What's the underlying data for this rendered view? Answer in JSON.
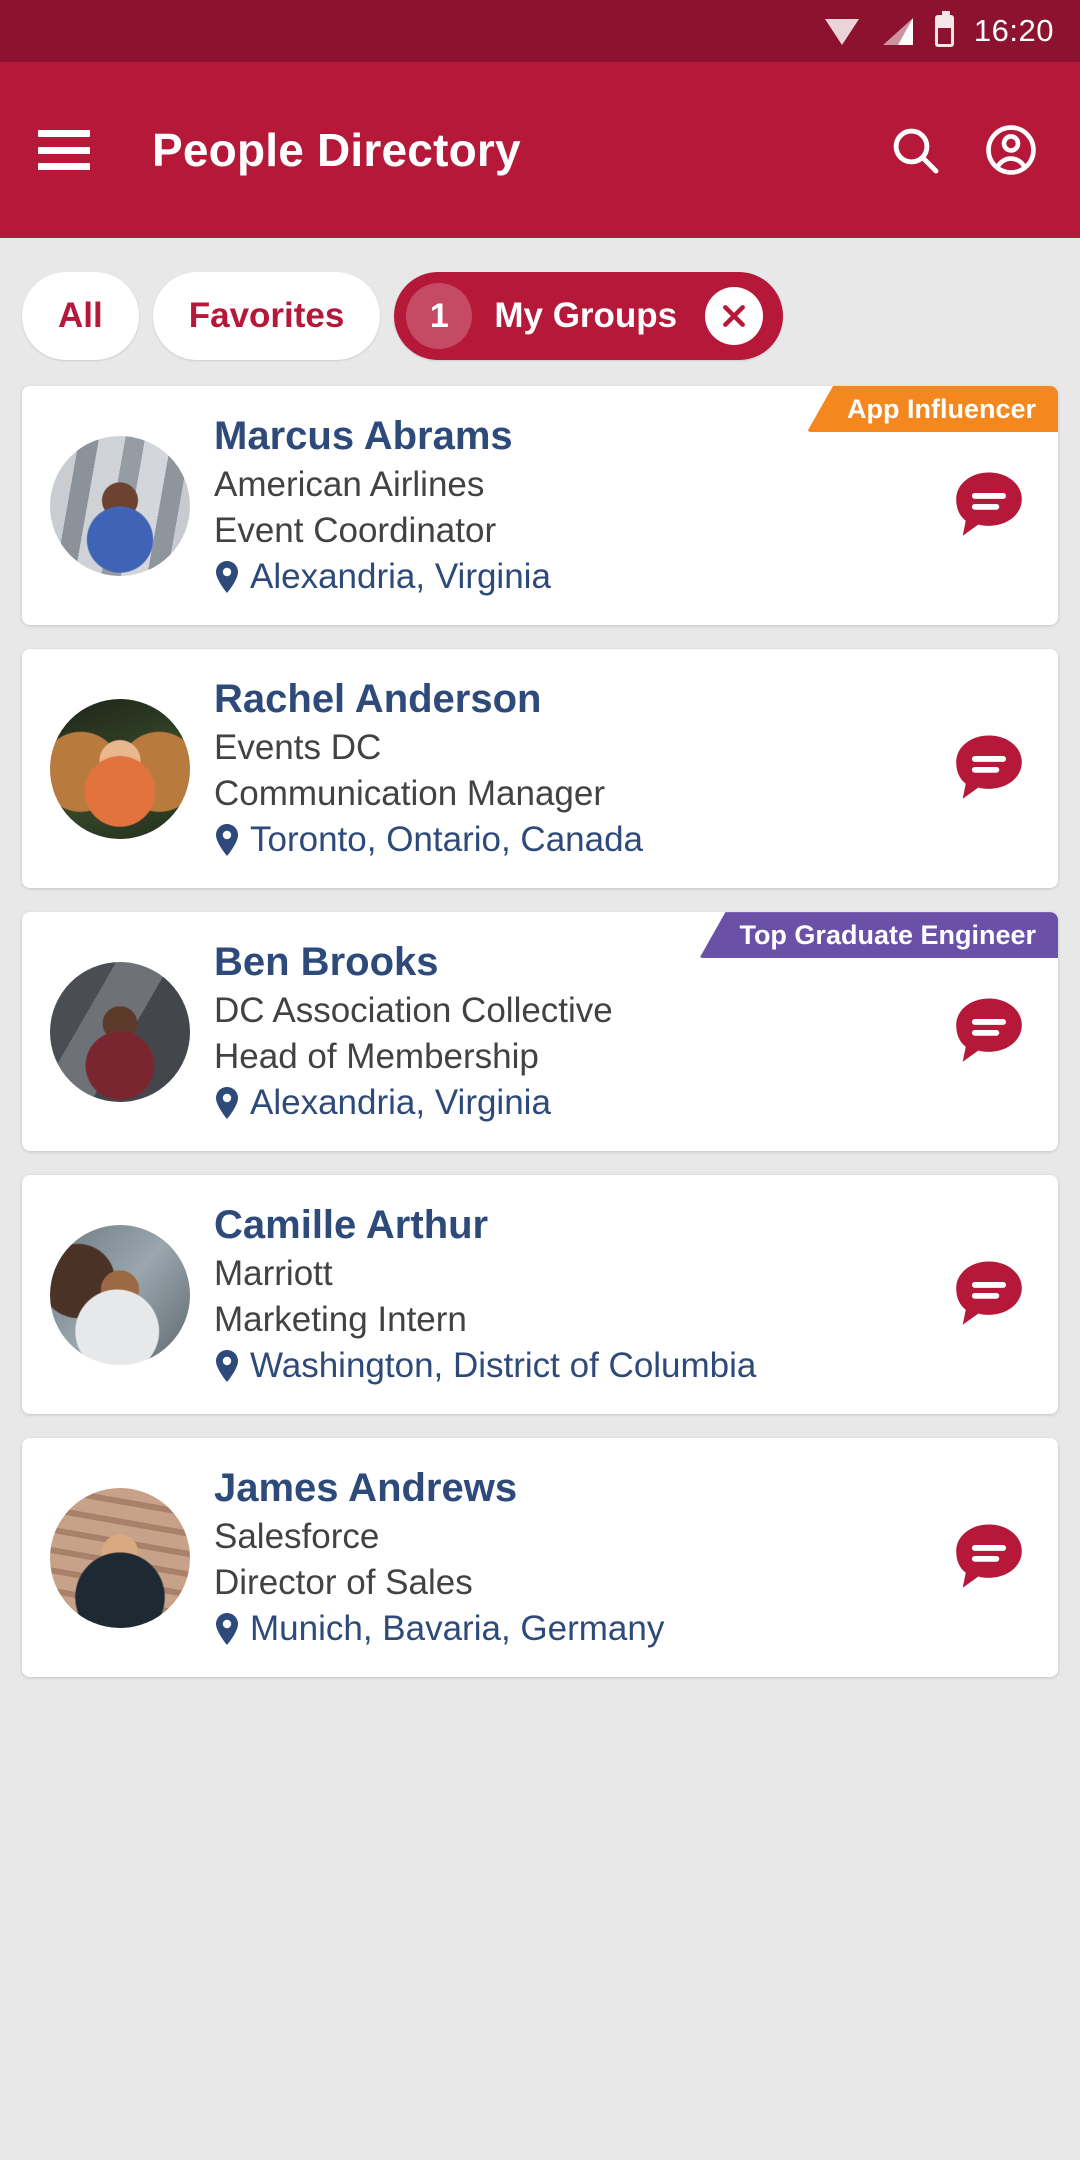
{
  "status_bar": {
    "time": "16:20",
    "icons": [
      "wifi-icon",
      "signal-icon",
      "battery-icon"
    ]
  },
  "app_bar": {
    "title": "People Directory",
    "menu_icon": "hamburger-menu-icon",
    "search_icon": "search-icon",
    "account_icon": "account-icon"
  },
  "filters": {
    "chips": [
      {
        "label": "All",
        "active": false
      },
      {
        "label": "Favorites",
        "active": false
      },
      {
        "label": "My Groups",
        "active": true,
        "badge": "1",
        "close_icon": "close-icon"
      }
    ]
  },
  "colors": {
    "status_bar": "#8c1230",
    "app_bar": "#b51838",
    "accent": "#b51838",
    "page_background": "#e8e8e8",
    "card_background": "#ffffff",
    "name_text": "#2d4a7a",
    "body_text": "#424242",
    "badge_orange": "#f5871f",
    "badge_purple": "#6b50a8"
  },
  "people": [
    {
      "name": "Marcus Abrams",
      "company": "American Airlines",
      "title": "Event Coordinator",
      "location": "Alexandria, Virginia",
      "ribbon": "App Influencer",
      "ribbon_color": "#f5871f",
      "message_icon": "message-icon",
      "location_icon": "location-pin-icon",
      "avatar": "av1"
    },
    {
      "name": "Rachel Anderson",
      "company": "Events DC",
      "title": "Communication Manager",
      "location": "Toronto, Ontario, Canada",
      "ribbon": "",
      "ribbon_color": "",
      "message_icon": "message-icon",
      "location_icon": "location-pin-icon",
      "avatar": "av2"
    },
    {
      "name": "Ben Brooks",
      "company": "DC Association Collective",
      "title": "Head of Membership",
      "location": "Alexandria, Virginia",
      "ribbon": "Top Graduate Engineer",
      "ribbon_color": "#6b50a8",
      "message_icon": "message-icon",
      "location_icon": "location-pin-icon",
      "avatar": "av3"
    },
    {
      "name": "Camille Arthur",
      "company": "Marriott",
      "title": "Marketing Intern",
      "location": "Washington, District of Columbia",
      "ribbon": "",
      "ribbon_color": "",
      "message_icon": "message-icon",
      "location_icon": "location-pin-icon",
      "avatar": "av4"
    },
    {
      "name": "James Andrews",
      "company": "Salesforce",
      "title": "Director of Sales",
      "location": "Munich, Bavaria, Germany",
      "ribbon": "",
      "ribbon_color": "",
      "message_icon": "message-icon",
      "location_icon": "location-pin-icon",
      "avatar": "av5"
    }
  ]
}
